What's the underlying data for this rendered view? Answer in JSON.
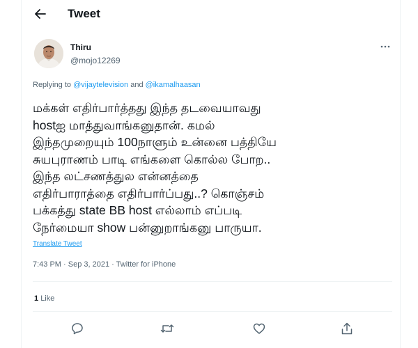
{
  "header": {
    "title": "Tweet"
  },
  "author": {
    "name": "Thiru",
    "handle": "@mojo12269"
  },
  "replying": {
    "prefix": "Replying to",
    "mention1": "@vijaytelevision",
    "conjunction": "and",
    "mention2": "@ikamalhaasan"
  },
  "tweet": {
    "text": "மக்கள் எதிர்பார்த்தது இந்த தடவையாவது\nhostஐ மாத்துவாங்கனுதான். கமல்\nஇந்தமுறையும் 100நாளும் உன்னை பத்தியே\nசுயபுராணம் பாடி எங்களை கொல்ல போற..\nஇந்த லட்சணத்துல என்னத்தை\nஎதிர்பாராத்தை எதிர்பார்ப்பது..? கொஞ்சம்\nபக்கத்து state BB host எல்லாம் எப்படி\nநேர்மையா show பன்னுறாங்கனு பாருயா.",
    "translate_label": "Translate Tweet",
    "timestamp": "7:43 PM · Sep 3, 2021",
    "separator": " · ",
    "source": "Twitter for iPhone"
  },
  "stats": {
    "likes_count": "1",
    "likes_label": "Like"
  },
  "colors": {
    "accent": "#1d9bf0",
    "text": "#0f1419",
    "muted": "#536471",
    "border": "#eff3f4"
  },
  "icons": {
    "back": "arrow-left-icon",
    "more": "more-dots-icon",
    "reply": "reply-icon",
    "retweet": "retweet-icon",
    "like": "heart-icon",
    "share": "share-icon"
  }
}
